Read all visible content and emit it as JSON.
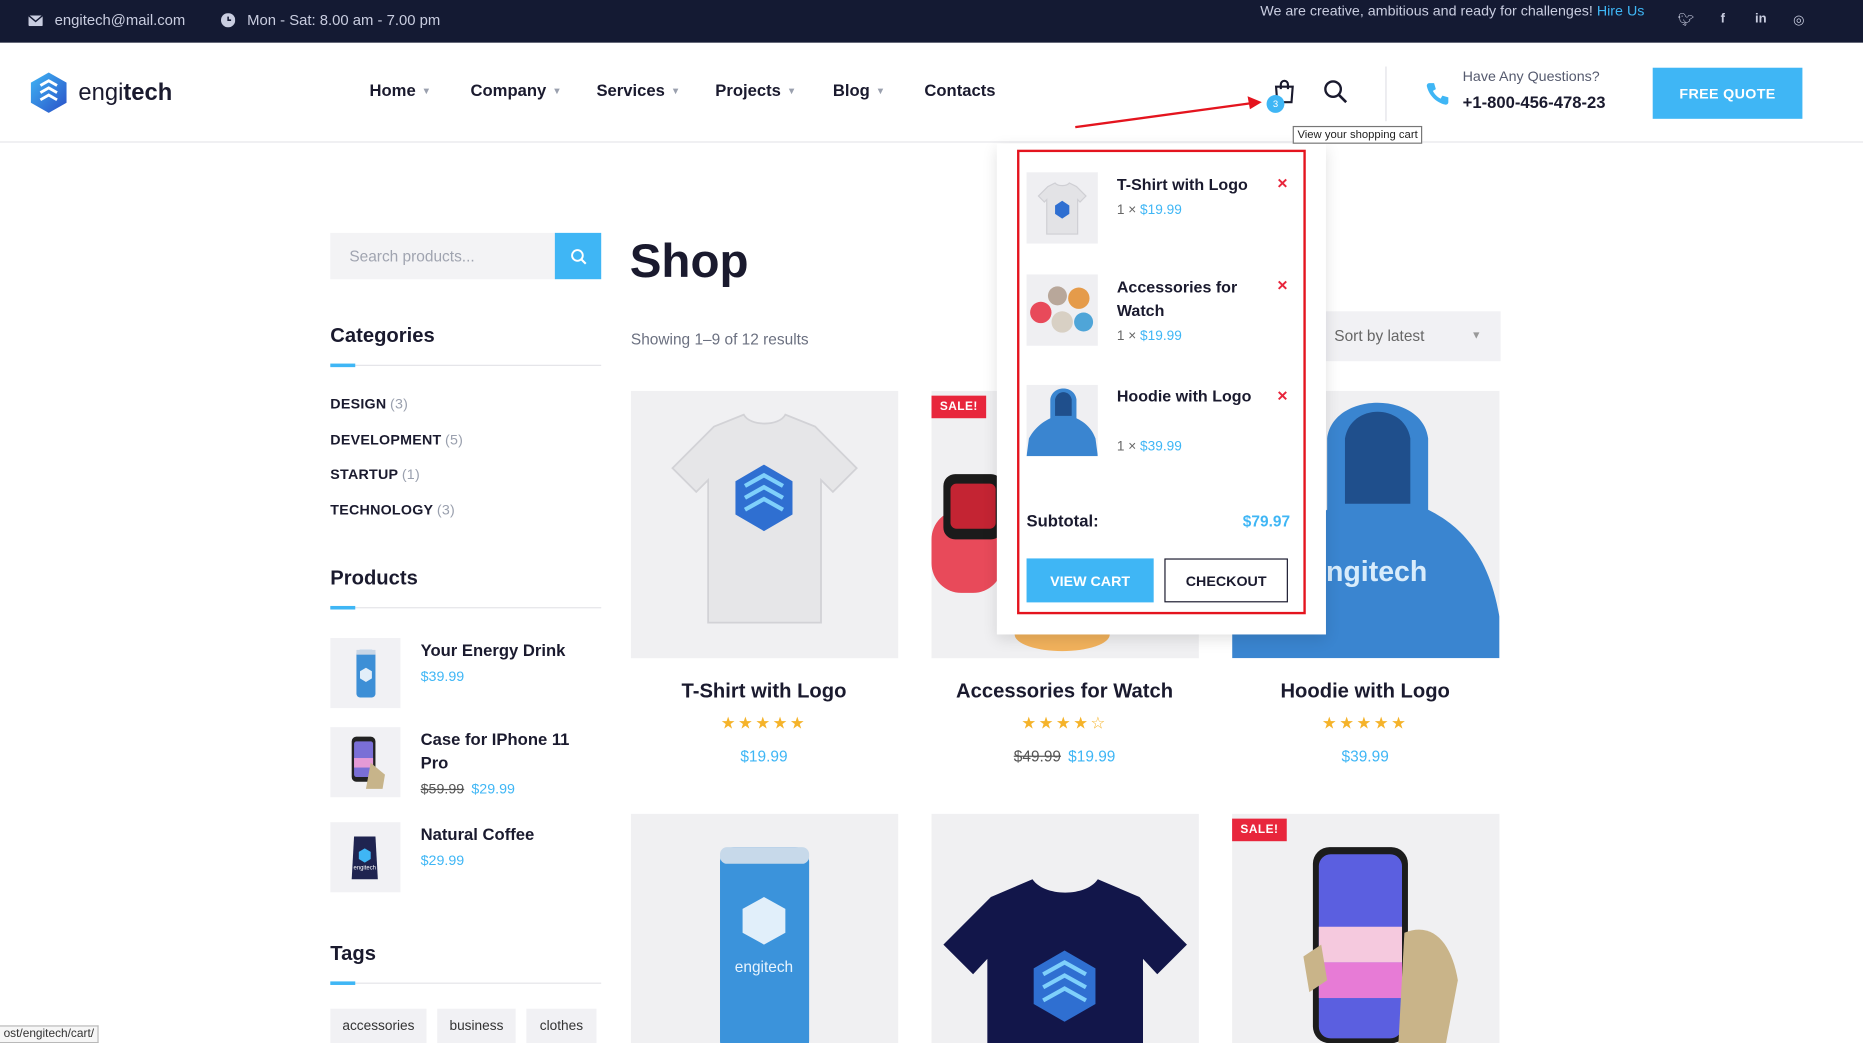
{
  "topbar": {
    "email": "engitech@mail.com",
    "hours": "Mon - Sat: 8.00 am - 7.00 pm",
    "tagline": "We are creative, ambitious and ready for challenges!",
    "hire_link": "Hire Us",
    "social": [
      "twitter-icon",
      "facebook-icon",
      "linkedin-icon",
      "instagram-icon"
    ]
  },
  "header": {
    "logo_pre": "engi",
    "logo_bold": "tech",
    "nav": [
      {
        "label": "Home",
        "caret": true
      },
      {
        "label": "Company",
        "caret": true
      },
      {
        "label": "Services",
        "caret": true
      },
      {
        "label": "Projects",
        "caret": true
      },
      {
        "label": "Blog",
        "caret": true
      },
      {
        "label": "Contacts",
        "caret": false
      }
    ],
    "cart_count": "3",
    "cart_tooltip": "View your shopping cart",
    "question_label": "Have Any Questions?",
    "phone": "+1-800-456-478-23",
    "quote_button": "FREE QUOTE"
  },
  "sidebar": {
    "search_placeholder": "Search products...",
    "categories_title": "Categories",
    "categories": [
      {
        "name": "DESIGN",
        "count": "(3)"
      },
      {
        "name": "DEVELOPMENT",
        "count": "(5)"
      },
      {
        "name": "STARTUP",
        "count": "(1)"
      },
      {
        "name": "TECHNOLOGY",
        "count": "(3)"
      }
    ],
    "products_title": "Products",
    "products": [
      {
        "name": "Your Energy Drink",
        "old_price": "",
        "price": "$39.99"
      },
      {
        "name": "Case for IPhone 11 Pro",
        "old_price": "$59.99",
        "price": "$29.99"
      },
      {
        "name": "Natural Coffee",
        "old_price": "",
        "price": "$29.99"
      }
    ],
    "tags_title": "Tags",
    "tags": [
      "accessories",
      "business",
      "clothes"
    ]
  },
  "main": {
    "title": "Shop",
    "showing": "Showing 1–9 of 12 results",
    "sort": "Sort by latest",
    "products": [
      {
        "name": "T-Shirt with Logo",
        "stars": "★★★★★",
        "old_price": "",
        "price": "$19.99",
        "sale": ""
      },
      {
        "name": "Accessories for Watch",
        "stars": "★★★★☆",
        "old_price": "$49.99",
        "price": "$19.99",
        "sale": "SALE!"
      },
      {
        "name": "Hoodie with Logo",
        "stars": "★★★★★",
        "old_price": "",
        "price": "$39.99",
        "sale": ""
      },
      {
        "name": "",
        "stars": "",
        "old_price": "",
        "price": "",
        "sale": ""
      },
      {
        "name": "",
        "stars": "",
        "old_price": "",
        "price": "",
        "sale": ""
      },
      {
        "name": "",
        "stars": "",
        "old_price": "",
        "price": "",
        "sale": "SALE!"
      }
    ],
    "can_brand": "engitech",
    "hoodie_brand": "engitech"
  },
  "mini_cart": {
    "items": [
      {
        "name": "T-Shirt with Logo",
        "qty": "1 ×",
        "price": "$19.99"
      },
      {
        "name": "Accessories for Watch",
        "qty": "1 ×",
        "price": "$19.99"
      },
      {
        "name": "Hoodie with Logo",
        "qty": "1 ×",
        "price": "$39.99"
      }
    ],
    "remove_symbol": "×",
    "subtotal_label": "Subtotal:",
    "subtotal_value": "$79.97",
    "view_cart": "VIEW CART",
    "checkout": "CHECKOUT"
  },
  "status_url": "ost/engitech/cart/",
  "colors": {
    "accent": "#3fb6f5",
    "dark": "#141a33",
    "sale": "#e8263c",
    "annotation": "#e4141e",
    "star": "#f5b32a"
  }
}
